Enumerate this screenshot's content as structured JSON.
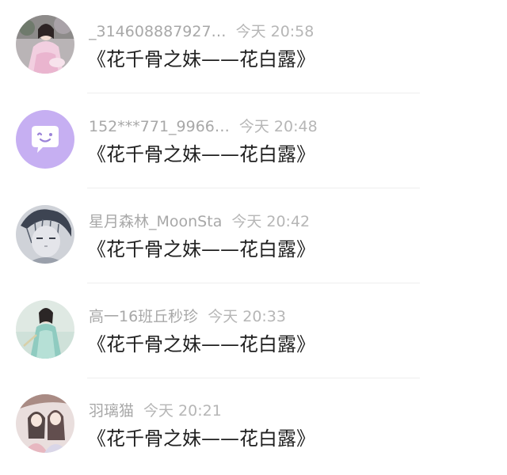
{
  "messages": [
    {
      "username": "_314608887927…",
      "time": "今天 20:58",
      "text": "《花千骨之妹——花白露》",
      "avatar_icon": "girl-in-pink-dress-avatar"
    },
    {
      "username": "152***771_9966…",
      "time": "今天 20:48",
      "text": "《花千骨之妹——花白露》",
      "avatar_icon": "purple-chat-bubble-avatar"
    },
    {
      "username": "星月森林_MoonSta",
      "time": "今天 20:42",
      "text": "《花千骨之妹——花白露》",
      "avatar_icon": "anime-boy-sketch-avatar"
    },
    {
      "username": "高一16班丘秒珍",
      "time": "今天 20:33",
      "text": "《花千骨之妹——花白露》",
      "avatar_icon": "woman-in-teal-hanfu-avatar"
    },
    {
      "username": "羽璃猫",
      "time": "今天 20:21",
      "text": "《花千骨之妹——花白露》",
      "avatar_icon": "two-anime-girls-avatar"
    }
  ],
  "colors": {
    "username": "#a8a8a8",
    "time": "#b6b6b6",
    "message": "#1f1f1f",
    "separator": "#eeeeee",
    "purple_avatar": "#c6aff2"
  }
}
